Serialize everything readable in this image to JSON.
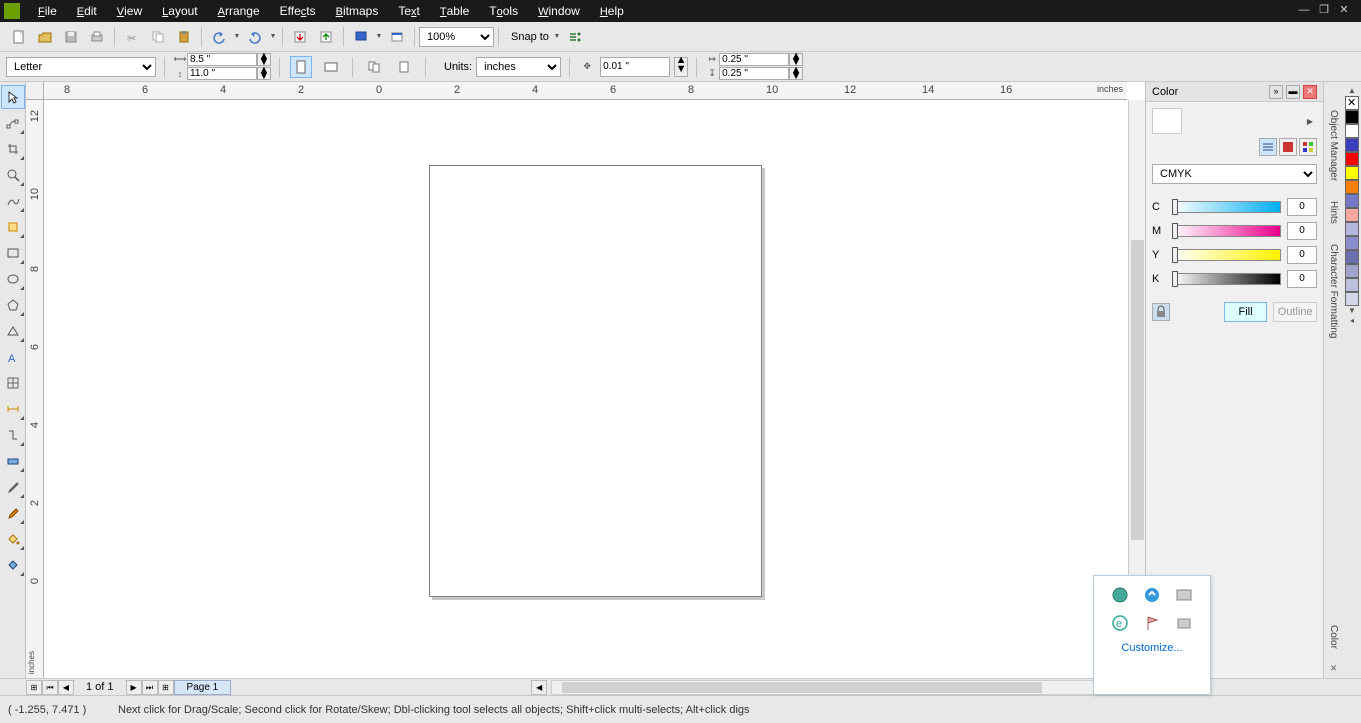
{
  "menu": {
    "items": [
      "File",
      "Edit",
      "View",
      "Layout",
      "Arrange",
      "Effects",
      "Bitmaps",
      "Text",
      "Table",
      "Tools",
      "Window",
      "Help"
    ]
  },
  "toolbar": {
    "zoom": "100%",
    "snap_label": "Snap to"
  },
  "propbar": {
    "paper": "Letter",
    "width": "8.5 \"",
    "height": "11.0 \"",
    "units_label": "Units:",
    "units_value": "inches",
    "nudge": "0.01 \"",
    "dupX": "0.25 \"",
    "dupY": "0.25 \""
  },
  "ruler": {
    "unit_h": "inches",
    "unit_v": "inches",
    "h_ticks": [
      "8",
      "6",
      "4",
      "2",
      "0",
      "2",
      "4",
      "6",
      "8",
      "10",
      "12",
      "14",
      "16"
    ],
    "v_ticks": [
      "12",
      "10",
      "8",
      "6",
      "4",
      "2",
      "0"
    ]
  },
  "colorDock": {
    "title": "Color",
    "model": "CMYK",
    "channels": [
      {
        "label": "C",
        "val": "0",
        "grad": "linear-gradient(to right,#fff,#00aeef)"
      },
      {
        "label": "M",
        "val": "0",
        "grad": "linear-gradient(to right,#fff,#ec008c)"
      },
      {
        "label": "Y",
        "val": "0",
        "grad": "linear-gradient(to right,#fff,#fff200)"
      },
      {
        "label": "K",
        "val": "0",
        "grad": "linear-gradient(to right,#fff,#000)"
      }
    ],
    "fill": "Fill",
    "outline": "Outline"
  },
  "sideTabs": [
    "Object Manager",
    "Hints",
    "Character Formatting"
  ],
  "paletteLabel": "Color",
  "paletteColors": [
    "#000000",
    "#ffffff",
    "#3b3fbf",
    "#ff0000",
    "#ffff00",
    "#ff8000",
    "#7779c6",
    "#f7a7a3",
    "#b4b6e0",
    "#8a8dcb",
    "#6b6fac",
    "#9fa3cc",
    "#bcbfd9",
    "#d6d7ea"
  ],
  "pageTabs": {
    "counter": "1 of 1",
    "page1": "Page 1"
  },
  "status": {
    "coords": "( -1.255, 7.471 )",
    "hint": "Next click for Drag/Scale; Second click for Rotate/Skew; Dbl-clicking tool selects all objects; Shift+click multi-selects; Alt+click digs"
  },
  "tray": {
    "customize": "Customize..."
  }
}
